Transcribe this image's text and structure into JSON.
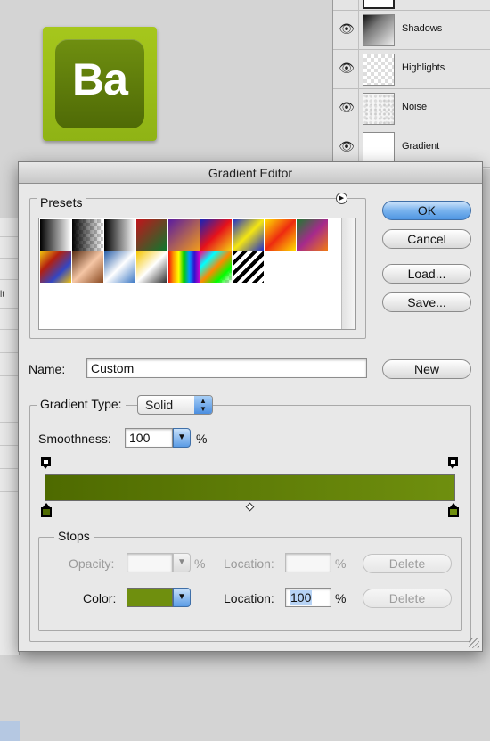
{
  "background": {
    "app_icon_text": "Ba",
    "left_strip_label": "lt",
    "layers": [
      {
        "name": "Shadows"
      },
      {
        "name": "Highlights"
      },
      {
        "name": "Noise"
      },
      {
        "name": "Gradient"
      }
    ]
  },
  "dialog": {
    "title": "Gradient Editor",
    "presets": {
      "title": "Presets",
      "swatch_count": 16
    },
    "buttons": {
      "ok": "OK",
      "cancel": "Cancel",
      "load": "Load...",
      "save": "Save...",
      "new": "New"
    },
    "name": {
      "label": "Name:",
      "value": "Custom"
    },
    "gradient_type": {
      "label": "Gradient Type:",
      "value": "Solid"
    },
    "smoothness": {
      "label": "Smoothness:",
      "value": "100",
      "unit": "%"
    },
    "gradient": {
      "start_color": "#4e6a00",
      "end_color": "#6f8f0e"
    },
    "stops": {
      "title": "Stops",
      "opacity_label": "Opacity:",
      "opacity_value": "",
      "opacity_unit": "%",
      "opacity_location_label": "Location:",
      "opacity_location_value": "",
      "opacity_location_unit": "%",
      "opacity_delete": "Delete",
      "color_label": "Color:",
      "color_value": "#6f8f0e",
      "color_location_label": "Location:",
      "color_location_value": "100",
      "color_location_unit": "%",
      "color_delete": "Delete"
    }
  }
}
